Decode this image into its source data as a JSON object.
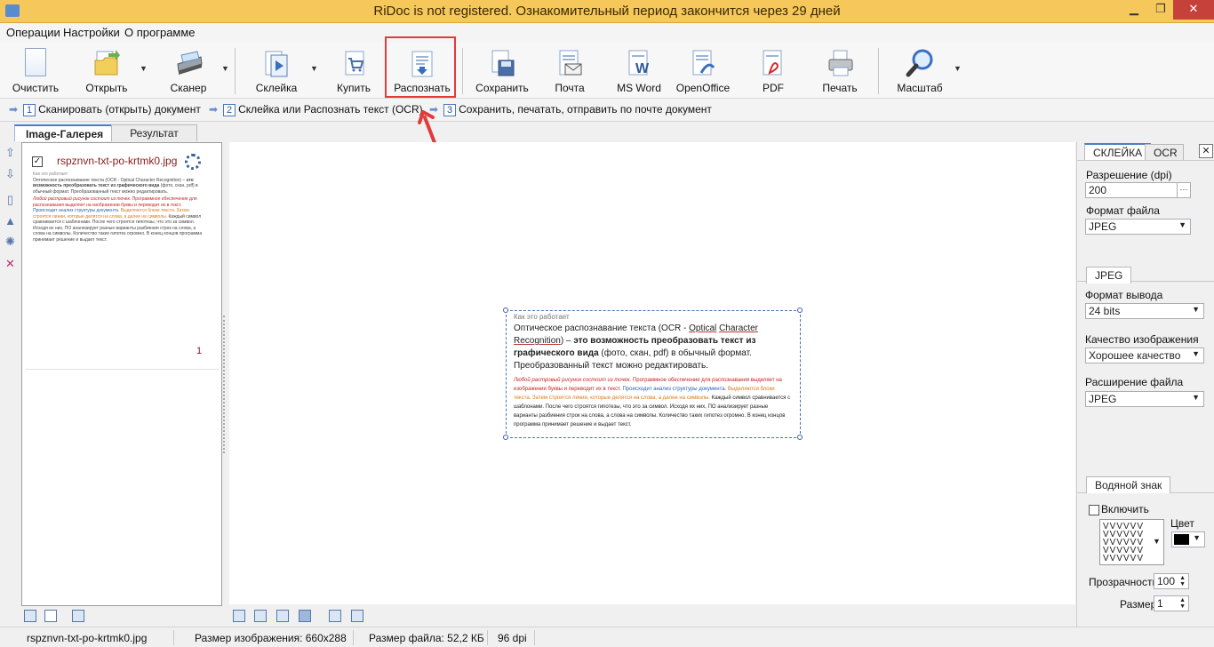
{
  "window": {
    "title": "RiDoc is not registered. Ознакомительный период закончится через 29 дней",
    "minimize": "▁",
    "maximize": "❐",
    "close": "✕"
  },
  "menu": [
    "Операции",
    "Настройки",
    "О программе"
  ],
  "toolbar": {
    "clear": "Очистить",
    "open": "Открыть",
    "scanner": "Сканер",
    "glue": "Склейка",
    "buy": "Купить",
    "recognize": "Распознать",
    "save": "Сохранить",
    "mail": "Почта",
    "msword": "MS Word",
    "openoffice": "OpenOffice",
    "pdf": "PDF",
    "print": "Печать",
    "zoom": "Масштаб"
  },
  "steps": [
    {
      "num": "1",
      "label": "Сканировать (открыть) документ"
    },
    {
      "num": "2",
      "label": "Склейка или Распознать текст (OCR)"
    },
    {
      "num": "3",
      "label": "Сохранить, печатать, отправить по почте документ"
    }
  ],
  "tabs": {
    "gallery": "Image-Галерея",
    "result": "Результат"
  },
  "gallery": {
    "item_name": "rspznvn-txt-po-krtmk0.jpg",
    "checked": "✓",
    "page_number": "1"
  },
  "document": {
    "small_header": "Как это работает",
    "p1_a": "Оптическое распознавание текста (OCR - ",
    "p1_link1": "Optical",
    "p1_link2": "Character",
    "p1_link3": "Recognition",
    "p1_b": ") – ",
    "p1_bold": "это возможность преобразовать текст из графического вида",
    "p1_c": " (фото, скан, pdf) в обычный формат. Преобразованный текст можно редактировать.",
    "p2_red_i": "Любой растровый рисунок состоит из точек.",
    "p2_red": " Программное обеспечение для распознавания выделяет на изображении буквы и переводит их в текст.",
    "p2_blue": " Происходит анализ структуры документа.",
    "p2_orange": " Выделяются блоки текста. Затем строятся линии, которые делятся на слова, а далее на символы.",
    "p2_black": " Каждый символ сравнивается с шаблонами. После чего строятся гипотезы, что это за символ. Исходя их них, ПО анализирует разные варианты разбиения строк на слова, а слова на символы. Количество таких гипотез огромно. В конец концов программа принимает решение и выдает текст."
  },
  "right_panel": {
    "tab_glue": "СКЛЕЙКА",
    "tab_ocr": "OCR",
    "close": "✕",
    "resolution_label": "Разрешение (dpi)",
    "resolution_value": "200",
    "resolution_btn": "···",
    "file_format_label": "Формат файла",
    "file_format_value": "JPEG",
    "jpeg_tab": "JPEG",
    "output_format_label": "Формат вывода",
    "output_format_value": "24 bits",
    "quality_label": "Качество изображения",
    "quality_value": "Хорошее качество",
    "extension_label": "Расширение файла",
    "extension_value": "JPEG",
    "watermark_tab": "Водяной знак",
    "enable_label": "Включить",
    "color_label": "Цвет",
    "watermark_pattern": "VVVVVV VVVVVV VVVVVV VVVVVV VVVVVV",
    "transparency_label": "Прозрачность",
    "transparency_value": "100",
    "size_label": "Размер",
    "size_value": "1"
  },
  "status": {
    "filename": "rspznvn-txt-po-krtmk0.jpg",
    "image_size": "Размер изображения: 660x288",
    "file_size": "Размер файла: 52,2 КБ",
    "dpi": "96 dpi"
  },
  "colors": {
    "title_bar": "#f6c75a",
    "highlight": "#e23b3b",
    "accent": "#4a7fc1"
  }
}
